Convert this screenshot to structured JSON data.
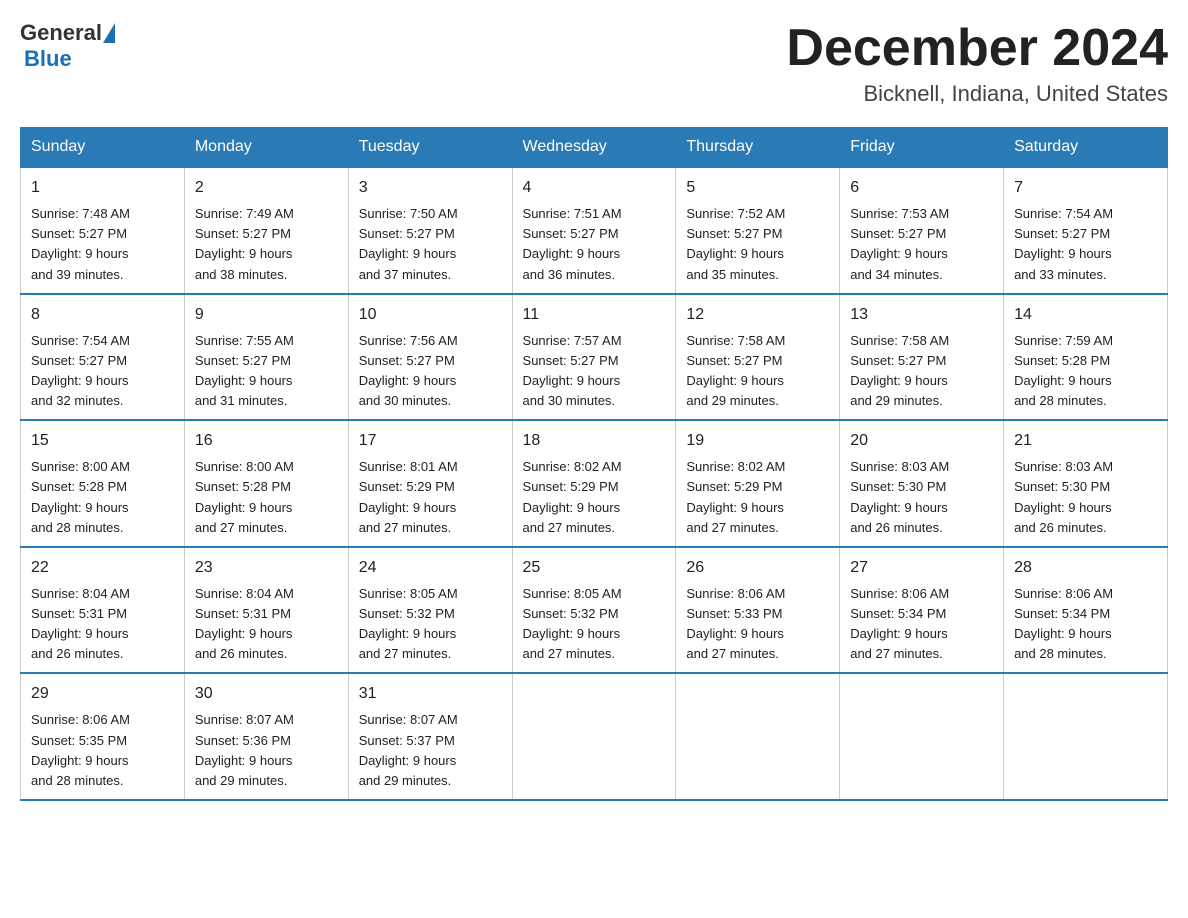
{
  "header": {
    "logo_general": "General",
    "logo_blue": "Blue",
    "month_title": "December 2024",
    "location": "Bicknell, Indiana, United States"
  },
  "weekdays": [
    "Sunday",
    "Monday",
    "Tuesday",
    "Wednesday",
    "Thursday",
    "Friday",
    "Saturday"
  ],
  "weeks": [
    [
      {
        "day": "1",
        "sunrise": "7:48 AM",
        "sunset": "5:27 PM",
        "daylight": "9 hours and 39 minutes."
      },
      {
        "day": "2",
        "sunrise": "7:49 AM",
        "sunset": "5:27 PM",
        "daylight": "9 hours and 38 minutes."
      },
      {
        "day": "3",
        "sunrise": "7:50 AM",
        "sunset": "5:27 PM",
        "daylight": "9 hours and 37 minutes."
      },
      {
        "day": "4",
        "sunrise": "7:51 AM",
        "sunset": "5:27 PM",
        "daylight": "9 hours and 36 minutes."
      },
      {
        "day": "5",
        "sunrise": "7:52 AM",
        "sunset": "5:27 PM",
        "daylight": "9 hours and 35 minutes."
      },
      {
        "day": "6",
        "sunrise": "7:53 AM",
        "sunset": "5:27 PM",
        "daylight": "9 hours and 34 minutes."
      },
      {
        "day": "7",
        "sunrise": "7:54 AM",
        "sunset": "5:27 PM",
        "daylight": "9 hours and 33 minutes."
      }
    ],
    [
      {
        "day": "8",
        "sunrise": "7:54 AM",
        "sunset": "5:27 PM",
        "daylight": "9 hours and 32 minutes."
      },
      {
        "day": "9",
        "sunrise": "7:55 AM",
        "sunset": "5:27 PM",
        "daylight": "9 hours and 31 minutes."
      },
      {
        "day": "10",
        "sunrise": "7:56 AM",
        "sunset": "5:27 PM",
        "daylight": "9 hours and 30 minutes."
      },
      {
        "day": "11",
        "sunrise": "7:57 AM",
        "sunset": "5:27 PM",
        "daylight": "9 hours and 30 minutes."
      },
      {
        "day": "12",
        "sunrise": "7:58 AM",
        "sunset": "5:27 PM",
        "daylight": "9 hours and 29 minutes."
      },
      {
        "day": "13",
        "sunrise": "7:58 AM",
        "sunset": "5:27 PM",
        "daylight": "9 hours and 29 minutes."
      },
      {
        "day": "14",
        "sunrise": "7:59 AM",
        "sunset": "5:28 PM",
        "daylight": "9 hours and 28 minutes."
      }
    ],
    [
      {
        "day": "15",
        "sunrise": "8:00 AM",
        "sunset": "5:28 PM",
        "daylight": "9 hours and 28 minutes."
      },
      {
        "day": "16",
        "sunrise": "8:00 AM",
        "sunset": "5:28 PM",
        "daylight": "9 hours and 27 minutes."
      },
      {
        "day": "17",
        "sunrise": "8:01 AM",
        "sunset": "5:29 PM",
        "daylight": "9 hours and 27 minutes."
      },
      {
        "day": "18",
        "sunrise": "8:02 AM",
        "sunset": "5:29 PM",
        "daylight": "9 hours and 27 minutes."
      },
      {
        "day": "19",
        "sunrise": "8:02 AM",
        "sunset": "5:29 PM",
        "daylight": "9 hours and 27 minutes."
      },
      {
        "day": "20",
        "sunrise": "8:03 AM",
        "sunset": "5:30 PM",
        "daylight": "9 hours and 26 minutes."
      },
      {
        "day": "21",
        "sunrise": "8:03 AM",
        "sunset": "5:30 PM",
        "daylight": "9 hours and 26 minutes."
      }
    ],
    [
      {
        "day": "22",
        "sunrise": "8:04 AM",
        "sunset": "5:31 PM",
        "daylight": "9 hours and 26 minutes."
      },
      {
        "day": "23",
        "sunrise": "8:04 AM",
        "sunset": "5:31 PM",
        "daylight": "9 hours and 26 minutes."
      },
      {
        "day": "24",
        "sunrise": "8:05 AM",
        "sunset": "5:32 PM",
        "daylight": "9 hours and 27 minutes."
      },
      {
        "day": "25",
        "sunrise": "8:05 AM",
        "sunset": "5:32 PM",
        "daylight": "9 hours and 27 minutes."
      },
      {
        "day": "26",
        "sunrise": "8:06 AM",
        "sunset": "5:33 PM",
        "daylight": "9 hours and 27 minutes."
      },
      {
        "day": "27",
        "sunrise": "8:06 AM",
        "sunset": "5:34 PM",
        "daylight": "9 hours and 27 minutes."
      },
      {
        "day": "28",
        "sunrise": "8:06 AM",
        "sunset": "5:34 PM",
        "daylight": "9 hours and 28 minutes."
      }
    ],
    [
      {
        "day": "29",
        "sunrise": "8:06 AM",
        "sunset": "5:35 PM",
        "daylight": "9 hours and 28 minutes."
      },
      {
        "day": "30",
        "sunrise": "8:07 AM",
        "sunset": "5:36 PM",
        "daylight": "9 hours and 29 minutes."
      },
      {
        "day": "31",
        "sunrise": "8:07 AM",
        "sunset": "5:37 PM",
        "daylight": "9 hours and 29 minutes."
      },
      null,
      null,
      null,
      null
    ]
  ],
  "labels": {
    "sunrise_prefix": "Sunrise: ",
    "sunset_prefix": "Sunset: ",
    "daylight_prefix": "Daylight: "
  }
}
